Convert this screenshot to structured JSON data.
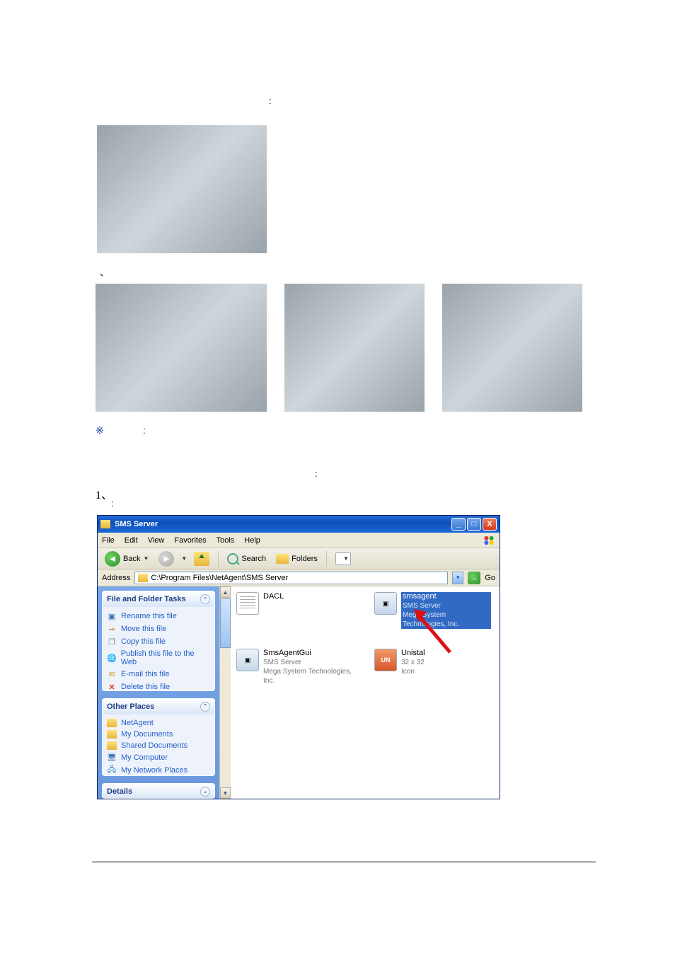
{
  "doc": {
    "colon1": ":",
    "caret": "、",
    "reference_sym": "※",
    "colon2": ":",
    "colon3": ":",
    "step1_num": "1、",
    "colon4": ":"
  },
  "explorer": {
    "title": "SMS Server",
    "minimize": "_",
    "maximize": "□",
    "close": "X",
    "menu": {
      "file": "File",
      "edit": "Edit",
      "view": "View",
      "favorites": "Favorites",
      "tools": "Tools",
      "help": "Help"
    },
    "toolbar": {
      "back": "Back",
      "search": "Search",
      "folders": "Folders"
    },
    "address_label": "Address",
    "address_path": "C:\\Program Files\\NetAgent\\SMS Server",
    "go": "Go",
    "tasks_panel": {
      "title": "File and Folder Tasks",
      "items": [
        "Rename this file",
        "Move this file",
        "Copy this file",
        "Publish this file to the Web",
        "E-mail this file",
        "Delete this file"
      ]
    },
    "places_panel": {
      "title": "Other Places",
      "items": [
        "NetAgent",
        "My Documents",
        "Shared Documents",
        "My Computer",
        "My Network Places"
      ]
    },
    "details_panel": {
      "title": "Details"
    },
    "files": {
      "dacl": {
        "name": "DACL"
      },
      "smsagent": {
        "name": "smsagent",
        "line2": "SMS Server",
        "line3": "Mega System Technologies, Inc."
      },
      "smsagentgui": {
        "name": "SmsAgentGui",
        "line2": "SMS Server",
        "line3": "Mega System Technologies, Inc."
      },
      "unistal": {
        "name": "Unistal",
        "line2": "32 x 32",
        "line3": "Icon"
      }
    }
  }
}
